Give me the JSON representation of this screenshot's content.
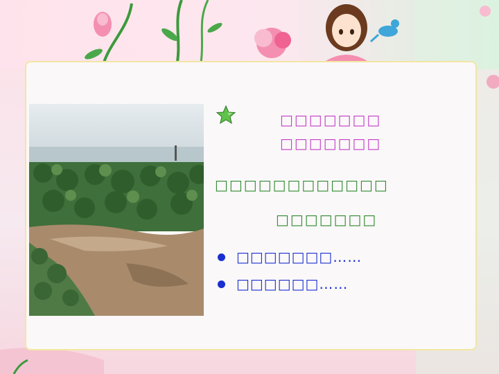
{
  "slide": {
    "title_line_1": "□□□□□□□",
    "title_line_2": "□□□□□□□",
    "green_line_1": "□□□□□□□□□□□□",
    "green_line_2": "□□□□□□□",
    "bullets": [
      {
        "text": "□□□□□□□……"
      },
      {
        "text": "□□□□□□……"
      }
    ]
  },
  "colors": {
    "title": "#c23cc8",
    "green_text": "#2f8a2f",
    "bullet_text": "#1a2fd1",
    "panel_border": "#f2e6a2"
  },
  "icons": {
    "star": "green-star-icon",
    "bullet": "blue-dot-icon"
  }
}
